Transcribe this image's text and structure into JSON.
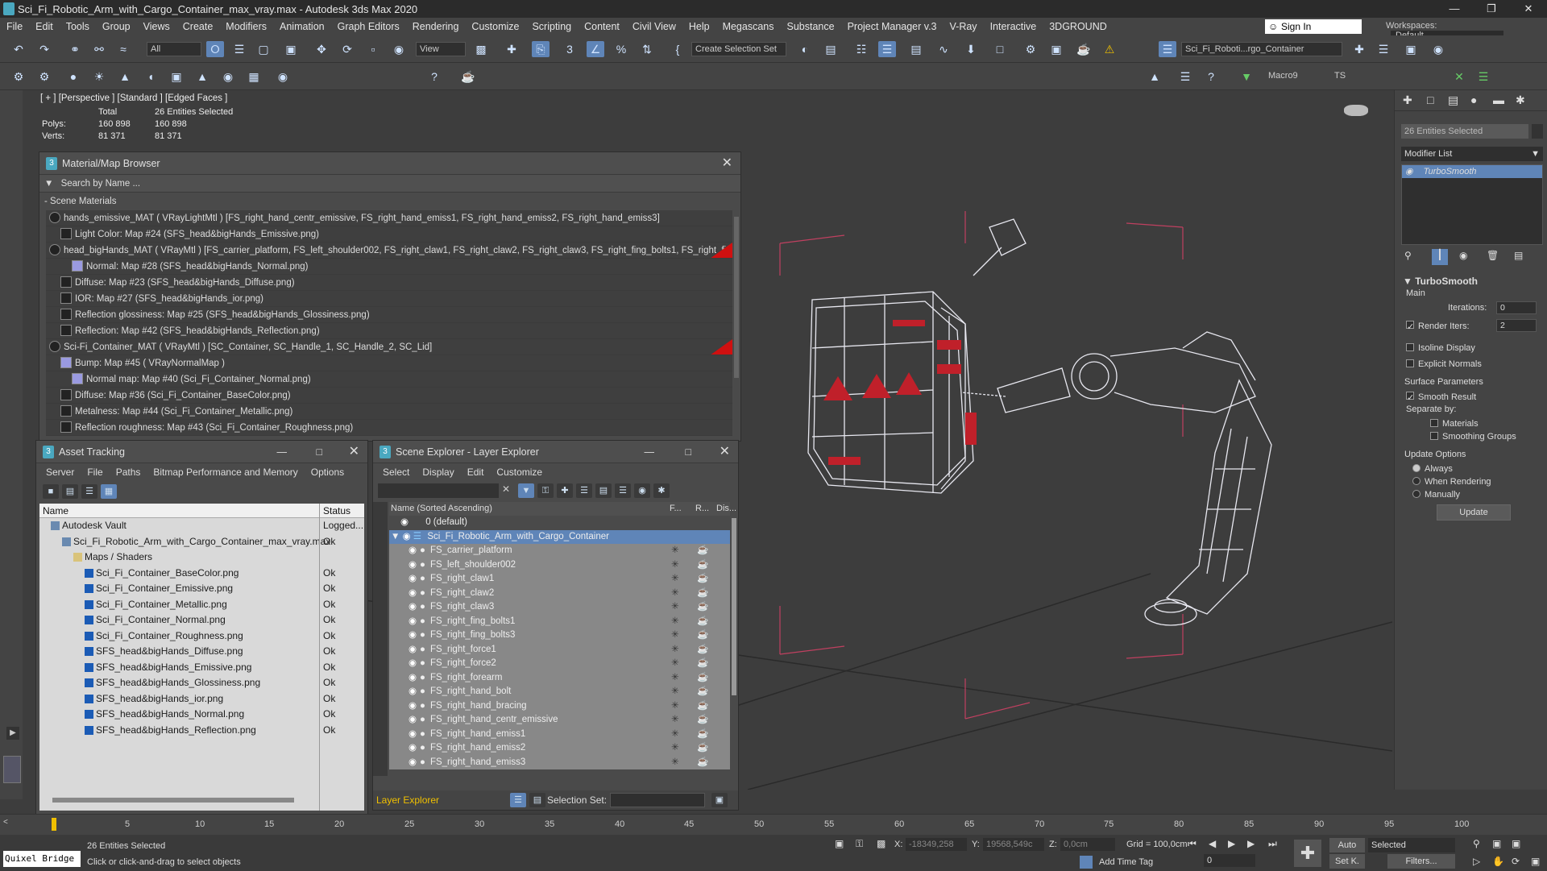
{
  "app": {
    "title": "Sci_Fi_Robotic_Arm_with_Cargo_Container_max_vray.max - Autodesk 3ds Max 2020",
    "menu": [
      "File",
      "Edit",
      "Tools",
      "Group",
      "Views",
      "Create",
      "Modifiers",
      "Animation",
      "Graph Editors",
      "Rendering",
      "Customize",
      "Scripting",
      "Content",
      "Civil View",
      "Help",
      "Megascans",
      "Substance",
      "Project Manager v.3",
      "V-Ray",
      "Interactive",
      "3DGROUND"
    ],
    "sign_in": "Sign In",
    "workspaces_label": "Workspaces:",
    "workspaces_value": "Default",
    "selection_filter": "All",
    "view_dropdown": "View",
    "create_selection_set": "Create Selection Set",
    "scene_dropdown": "Sci_Fi_Roboti...rgo_Container",
    "macro_label": "Macro9",
    "ts_label": "TS"
  },
  "viewport": {
    "label": "[ + ] [Perspective ] [Standard ] [Edged Faces ]",
    "stats": {
      "total_label": "Total",
      "selected_label": "26 Entities Selected",
      "polys_label": "Polys:",
      "polys_total": "160 898",
      "polys_sel": "160 898",
      "verts_label": "Verts:",
      "verts_total": "81 371",
      "verts_sel": "81 371"
    }
  },
  "material_browser": {
    "title": "Material/Map Browser",
    "search_placeholder": "Search by Name ...",
    "section": "- Scene Materials",
    "rows": [
      {
        "text": "hands_emissive_MAT  ( VRayLightMtl )  [FS_right_hand_centr_emissive, FS_right_hand_emiss1, FS_right_hand_emiss2, FS_right_hand_emiss3]",
        "indent": 0,
        "red": false
      },
      {
        "text": "Light Color: Map #24 (SFS_head&bigHands_Emissive.png)",
        "indent": 1,
        "red": false
      },
      {
        "text": "head_bigHands_MAT  ( VRayMtl )  [FS_carrier_platform, FS_left_shoulder002, FS_right_claw1, FS_right_claw2, FS_right_claw3, FS_right_fing_bolts1, FS_right_fing_bolt...",
        "indent": 0,
        "red": true
      },
      {
        "text": "Normal: Map #28 (SFS_head&bigHands_Normal.png)",
        "indent": 2,
        "red": false
      },
      {
        "text": "Diffuse: Map #23 (SFS_head&bigHands_Diffuse.png)",
        "indent": 1,
        "red": false
      },
      {
        "text": "IOR: Map #27 (SFS_head&bigHands_ior.png)",
        "indent": 1,
        "red": false
      },
      {
        "text": "Reflection glossiness: Map #25 (SFS_head&bigHands_Glossiness.png)",
        "indent": 1,
        "red": false
      },
      {
        "text": "Reflection: Map #42 (SFS_head&bigHands_Reflection.png)",
        "indent": 1,
        "red": false
      },
      {
        "text": "Sci-Fi_Container_MAT  ( VRayMtl )  [SC_Container, SC_Handle_1, SC_Handle_2, SC_Lid]",
        "indent": 0,
        "red": true
      },
      {
        "text": "Bump: Map #45  ( VRayNormalMap )",
        "indent": 1,
        "red": false
      },
      {
        "text": "Normal map: Map #40 (Sci_Fi_Container_Normal.png)",
        "indent": 2,
        "red": false
      },
      {
        "text": "Diffuse: Map #36 (Sci_Fi_Container_BaseColor.png)",
        "indent": 1,
        "red": false
      },
      {
        "text": "Metalness: Map #44 (Sci_Fi_Container_Metallic.png)",
        "indent": 1,
        "red": false
      },
      {
        "text": "Reflection roughness: Map #43 (Sci_Fi_Container_Roughness.png)",
        "indent": 1,
        "red": false
      }
    ]
  },
  "asset_tracking": {
    "title": "Asset Tracking",
    "menu": [
      "Server",
      "File",
      "Paths",
      "Bitmap Performance and Memory",
      "Options"
    ],
    "col_name": "Name",
    "col_status": "Status",
    "rows": [
      {
        "name": "Autodesk Vault",
        "status": "Logged...",
        "indent": 0
      },
      {
        "name": "Sci_Fi_Robotic_Arm_with_Cargo_Container_max_vray.max",
        "status": "Ok",
        "indent": 1
      },
      {
        "name": "Maps / Shaders",
        "status": "",
        "indent": 2
      },
      {
        "name": "Sci_Fi_Container_BaseColor.png",
        "status": "Ok",
        "indent": 3
      },
      {
        "name": "Sci_Fi_Container_Emissive.png",
        "status": "Ok",
        "indent": 3
      },
      {
        "name": "Sci_Fi_Container_Metallic.png",
        "status": "Ok",
        "indent": 3
      },
      {
        "name": "Sci_Fi_Container_Normal.png",
        "status": "Ok",
        "indent": 3
      },
      {
        "name": "Sci_Fi_Container_Roughness.png",
        "status": "Ok",
        "indent": 3
      },
      {
        "name": "SFS_head&bigHands_Diffuse.png",
        "status": "Ok",
        "indent": 3
      },
      {
        "name": "SFS_head&bigHands_Emissive.png",
        "status": "Ok",
        "indent": 3
      },
      {
        "name": "SFS_head&bigHands_Glossiness.png",
        "status": "Ok",
        "indent": 3
      },
      {
        "name": "SFS_head&bigHands_ior.png",
        "status": "Ok",
        "indent": 3
      },
      {
        "name": "SFS_head&bigHands_Normal.png",
        "status": "Ok",
        "indent": 3
      },
      {
        "name": "SFS_head&bigHands_Reflection.png",
        "status": "Ok",
        "indent": 3
      }
    ]
  },
  "scene_explorer": {
    "title": "Scene Explorer - Layer Explorer",
    "menu": [
      "Select",
      "Display",
      "Edit",
      "Customize"
    ],
    "col_name": "Name (Sorted Ascending)",
    "col_f": "F...",
    "col_r": "R...",
    "col_d": "Dis...",
    "default_layer": "0 (default)",
    "layer": "Sci_Fi_Robotic_Arm_with_Cargo_Container",
    "objects": [
      "FS_carrier_platform",
      "FS_left_shoulder002",
      "FS_right_claw1",
      "FS_right_claw2",
      "FS_right_claw3",
      "FS_right_fing_bolts1",
      "FS_right_fing_bolts3",
      "FS_right_force1",
      "FS_right_force2",
      "FS_right_forearm",
      "FS_right_hand_bolt",
      "FS_right_hand_bracing",
      "FS_right_hand_centr_emissive",
      "FS_right_hand_emiss1",
      "FS_right_hand_emiss2",
      "FS_right_hand_emiss3"
    ],
    "footer_label": "Layer Explorer",
    "selection_set_label": "Selection Set:"
  },
  "command_panel": {
    "entities_selected": "26 Entities Selected",
    "modifier_list": "Modifier List",
    "modifier": "TurboSmooth",
    "rollout": "TurboSmooth",
    "main": "Main",
    "iterations_label": "Iterations:",
    "iterations": "0",
    "render_iters_label": "Render Iters:",
    "render_iters": "2",
    "isoline": "Isoline Display",
    "explicit": "Explicit Normals",
    "surface_params": "Surface Parameters",
    "smooth_result": "Smooth Result",
    "separate_by": "Separate by:",
    "materials": "Materials",
    "smoothing_groups": "Smoothing Groups",
    "update_options": "Update Options",
    "always": "Always",
    "when_rendering": "When Rendering",
    "manually": "Manually",
    "update_btn": "Update"
  },
  "timeline": {
    "ticks": [
      "5",
      "10",
      "15",
      "20",
      "25",
      "30",
      "35",
      "40",
      "45",
      "50",
      "55",
      "60",
      "65",
      "70",
      "75",
      "80",
      "85",
      "90",
      "95",
      "100"
    ]
  },
  "status": {
    "quixel": "Quixel Bridge",
    "selected": "26 Entities Selected",
    "prompt": "Click or click-and-drag to select objects",
    "x_label": "X:",
    "x_val": "-18349,258",
    "y_label": "Y:",
    "y_val": "19568,549c",
    "z_label": "Z:",
    "z_val": "0,0cm",
    "grid": "Grid = 100,0cm",
    "add_time_tag": "Add Time Tag",
    "auto": "Auto",
    "selected_dd": "Selected",
    "set_k": "Set K.",
    "filters": "Filters...",
    "frame": "0"
  }
}
